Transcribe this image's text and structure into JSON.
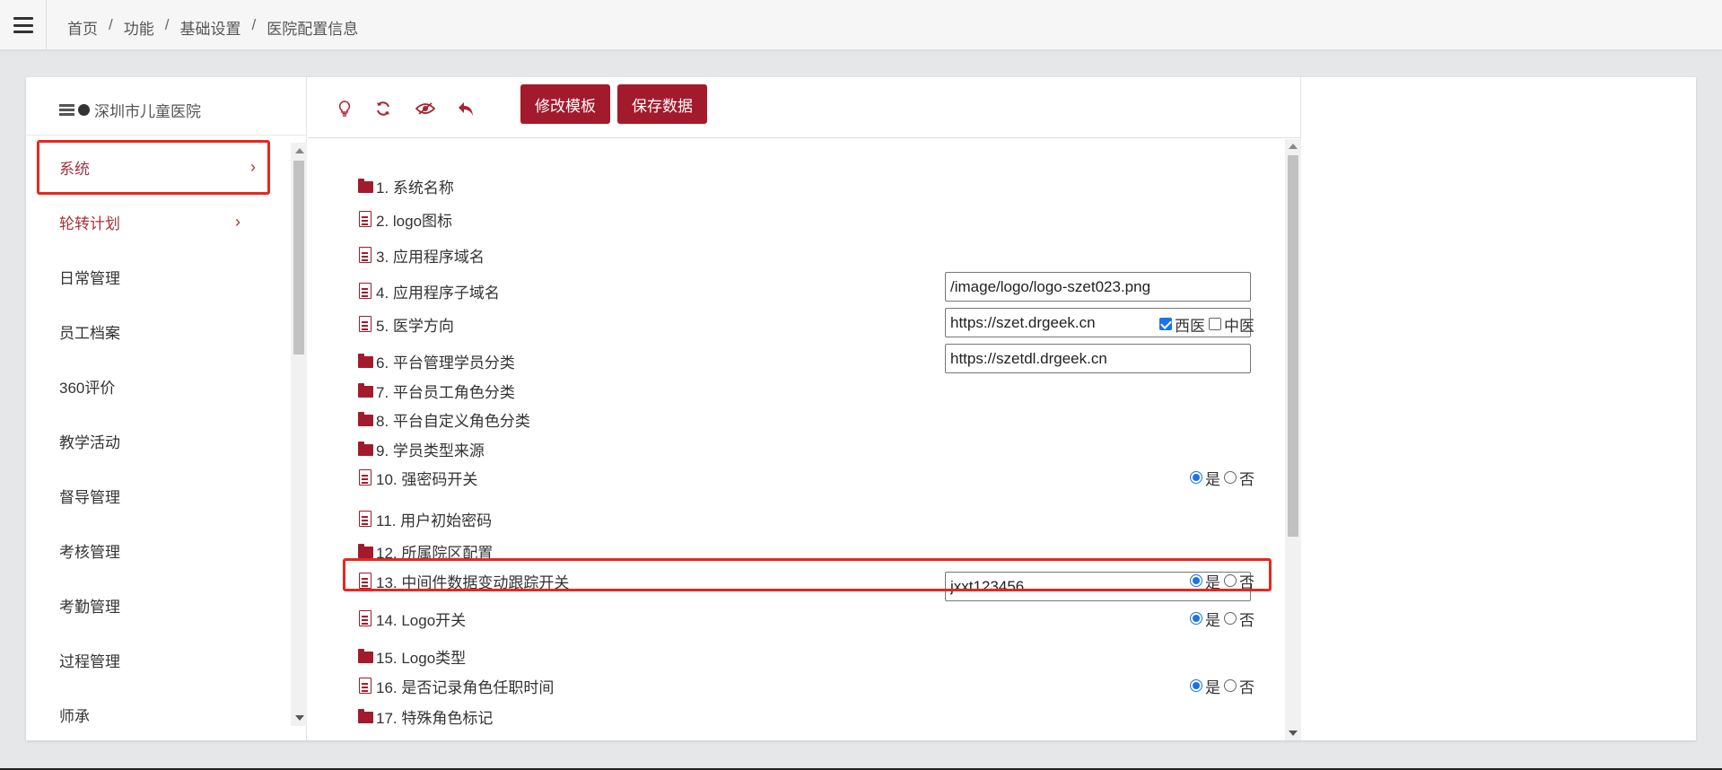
{
  "breadcrumb": [
    "首页",
    "功能",
    "基础设置",
    "医院配置信息"
  ],
  "breadcrumb_sep": "/",
  "hospital": {
    "name": "深圳市儿童医院"
  },
  "menu": [
    {
      "label": "系统",
      "red": true,
      "chevron": "›"
    },
    {
      "label": "轮转计划",
      "red": true,
      "chevron": "›"
    },
    {
      "label": "日常管理"
    },
    {
      "label": "员工档案"
    },
    {
      "label": "360评价"
    },
    {
      "label": "教学活动"
    },
    {
      "label": "督导管理"
    },
    {
      "label": "考核管理"
    },
    {
      "label": "考勤管理"
    },
    {
      "label": "过程管理"
    },
    {
      "label": "师承"
    }
  ],
  "toolbar": {
    "icons": [
      "lightbulb-icon",
      "refresh-icon",
      "eye-slash-icon",
      "reply-icon"
    ],
    "edit_template_label": "修改模板",
    "save_data_label": "保存数据"
  },
  "config": [
    {
      "label": "1. 系统名称",
      "type": "folder"
    },
    {
      "label": "2. logo图标",
      "type": "doc",
      "input": "/image/logo/logo-szet023.png"
    },
    {
      "label": "3. 应用程序域名",
      "type": "doc",
      "input": "https://szet.drgeek.cn"
    },
    {
      "label": "4. 应用程序子域名",
      "type": "doc",
      "input": "https://szetdl.drgeek.cn"
    },
    {
      "label": "5. 医学方向",
      "type": "doc",
      "checks": [
        {
          "label": "西医",
          "on": true
        },
        {
          "label": "中医",
          "on": false
        }
      ]
    },
    {
      "label": "6. 平台管理学员分类",
      "type": "folder"
    },
    {
      "label": "7. 平台员工角色分类",
      "type": "folder"
    },
    {
      "label": "8. 平台自定义角色分类",
      "type": "folder"
    },
    {
      "label": "9. 学员类型来源",
      "type": "folder"
    },
    {
      "label": "10. 强密码开关",
      "type": "doc",
      "radio": "是"
    },
    {
      "label": "11. 用户初始密码",
      "type": "doc",
      "input": "jxxt123456"
    },
    {
      "label": "12. 所属院区配置",
      "type": "folder"
    },
    {
      "label": "13. 中间件数据变动跟踪开关",
      "type": "doc",
      "radio": "是"
    },
    {
      "label": "14. Logo开关",
      "type": "doc",
      "radio": "是"
    },
    {
      "label": "15. Logo类型",
      "type": "folder"
    },
    {
      "label": "16. 是否记录角色任职时间",
      "type": "doc",
      "radio": "是"
    },
    {
      "label": "17. 特殊角色标记",
      "type": "folder"
    }
  ],
  "radio_labels": {
    "yes": "是",
    "no": "否"
  },
  "colors": {
    "accent": "#a31a2c",
    "highlight": "#e6281e",
    "checked": "#1a73e8"
  }
}
